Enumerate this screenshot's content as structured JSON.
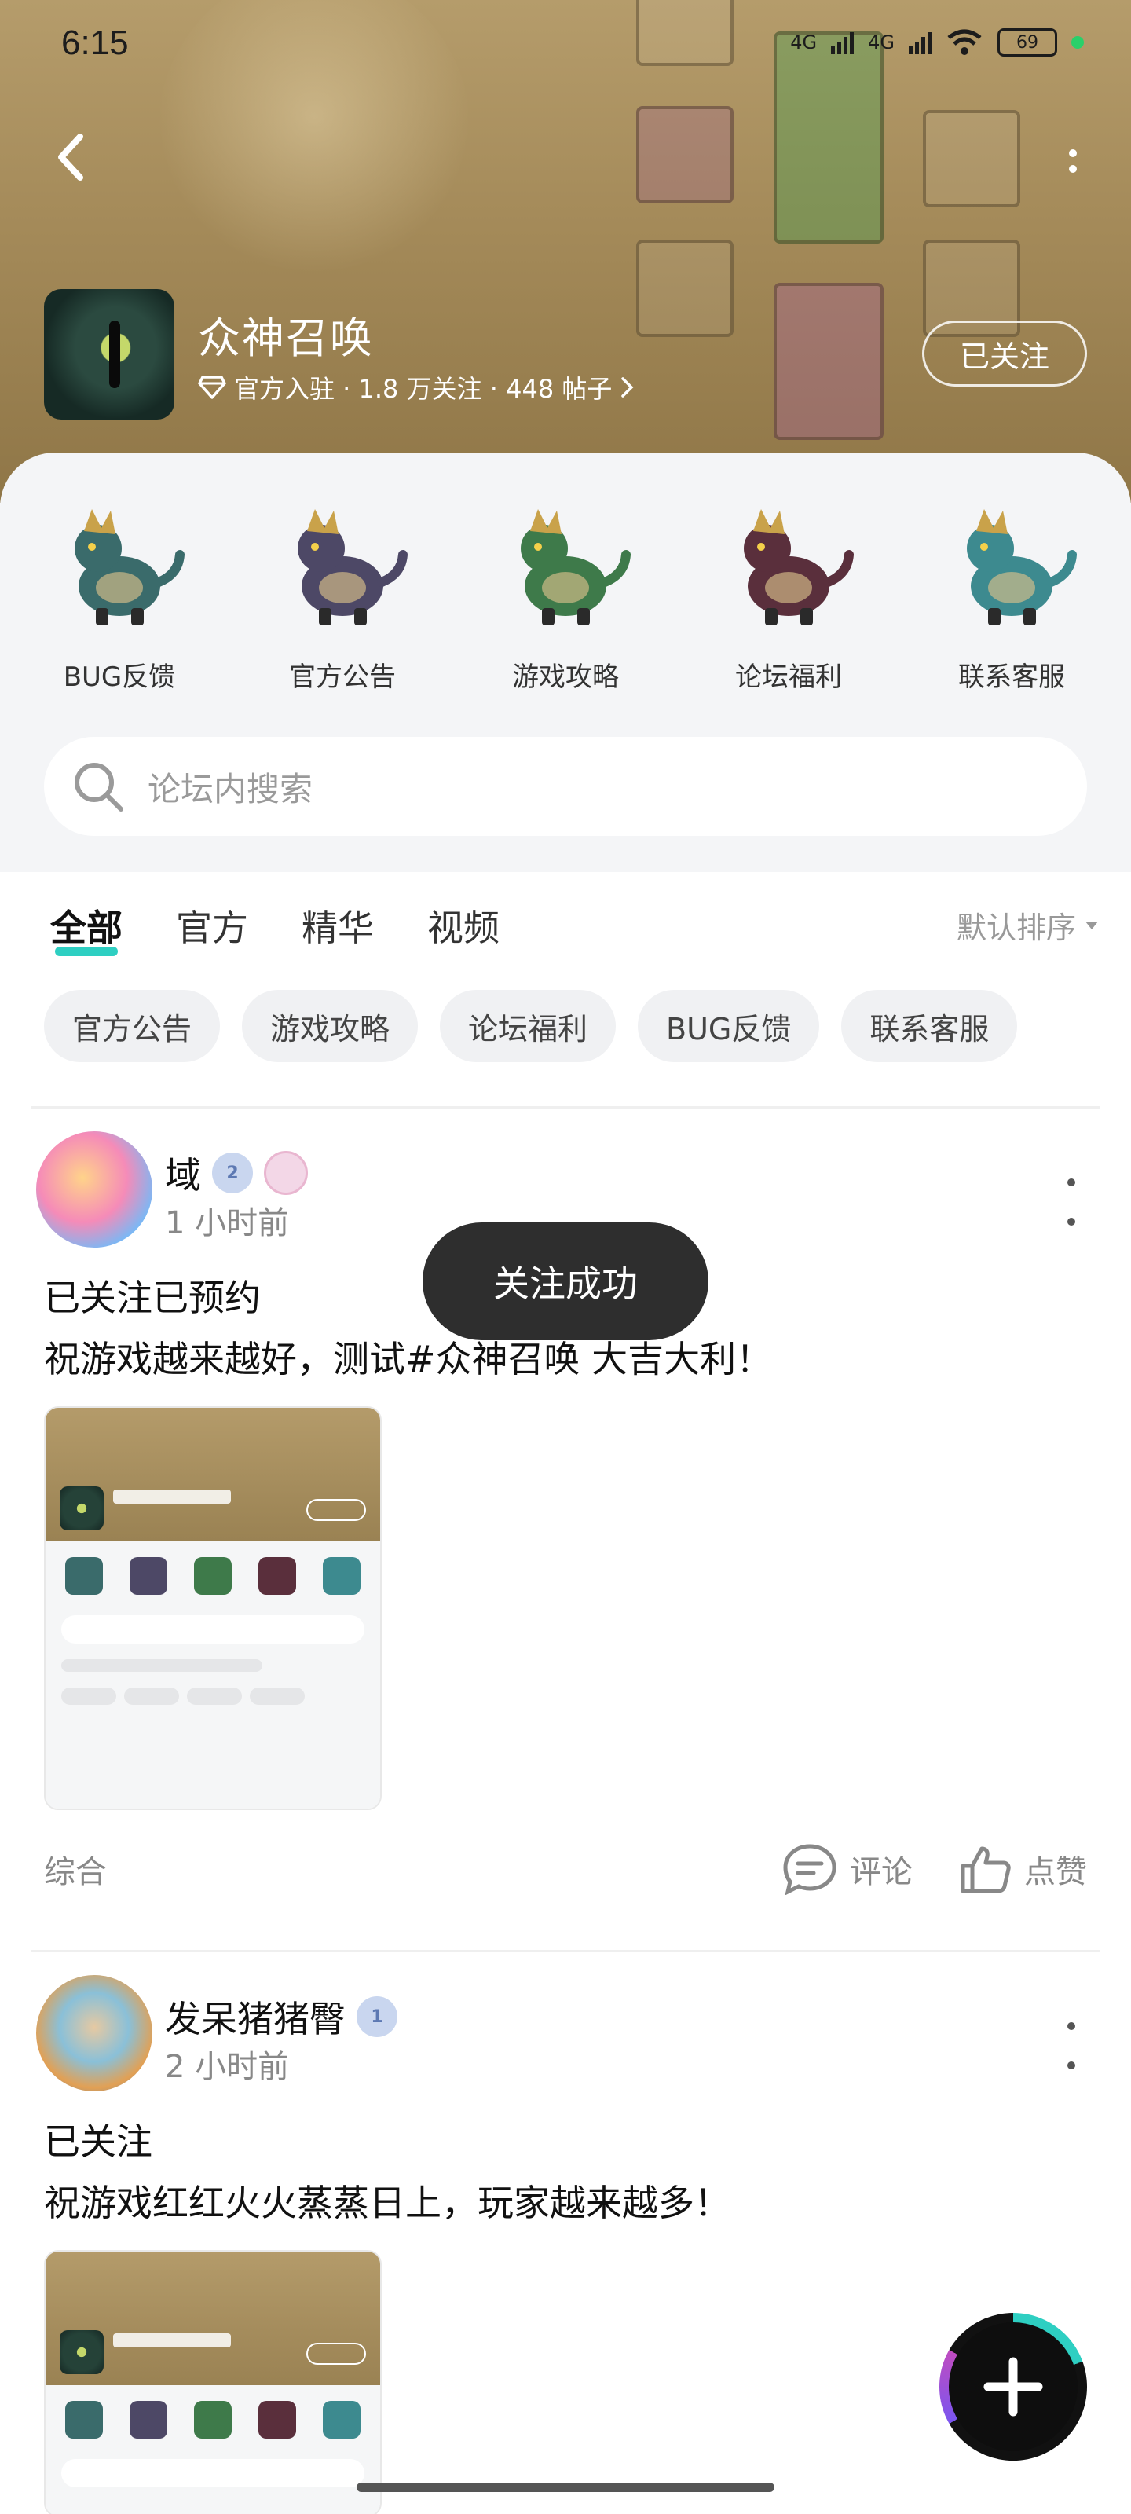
{
  "status": {
    "time": "6:15",
    "net1": "4G",
    "net2": "4G",
    "battery": "69"
  },
  "header": {
    "title": "众神召唤",
    "meta": "官方入驻 · 1.8 万关注 · 448 帖子",
    "follow_label": "已关注"
  },
  "categories": [
    {
      "label": "BUG反馈",
      "color": "#3a6b6b"
    },
    {
      "label": "官方公告",
      "color": "#4d4866"
    },
    {
      "label": "游戏攻略",
      "color": "#3e7a4a"
    },
    {
      "label": "论坛福利",
      "color": "#5a2f3c"
    },
    {
      "label": "联系客服",
      "color": "#3d8a8f"
    }
  ],
  "search": {
    "placeholder": "论坛内搜索"
  },
  "tabs": [
    "全部",
    "官方",
    "精华",
    "视频"
  ],
  "sort_label": "默认排序",
  "chips": [
    "官方公告",
    "游戏攻略",
    "论坛福利",
    "BUG反馈",
    "联系客服"
  ],
  "posts": [
    {
      "username": "域",
      "badge_level": "2",
      "time": "1 小时前",
      "title": "已关注已预约",
      "body": "祝游戏越来越好，测试#众神召唤 大吉大利！",
      "category": "综合",
      "comment_label": "评论",
      "like_label": "点赞"
    },
    {
      "username": "发呆猪猪臀",
      "badge_level": "1",
      "time": "2 小时前",
      "title": "已关注",
      "body": "祝游戏红红火火蒸蒸日上，玩家越来越多！"
    }
  ],
  "toast": "关注成功",
  "colors": {
    "accent": "#2ecfc2",
    "banner": "#a48a59"
  }
}
